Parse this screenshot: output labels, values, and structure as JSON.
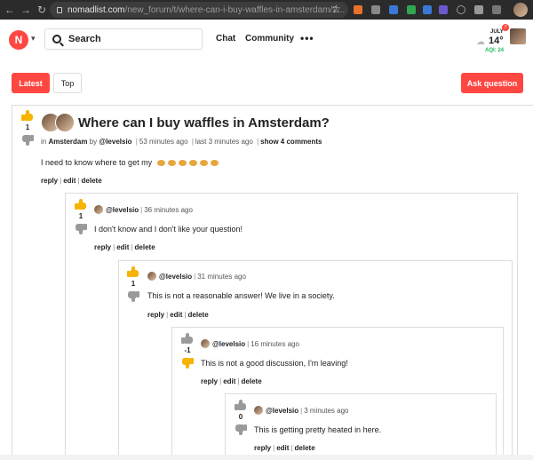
{
  "browser": {
    "url_domain": "nomadlist.com",
    "url_path": "/new_forum/t/where-can-i-buy-waffles-in-amsterdam/2..."
  },
  "header": {
    "logo_text": "N",
    "search_placeholder": "Search",
    "nav": {
      "chat": "Chat",
      "community": "Community",
      "more": "•••"
    },
    "weather": {
      "month": "JULY",
      "badge": "7",
      "temp": "14°",
      "aqi": "AQI: 24"
    }
  },
  "tabs": {
    "latest": "Latest",
    "top": "Top",
    "ask": "Ask question"
  },
  "colors": {
    "accent": "#ff4742",
    "vote_active": "#f5b400",
    "vote_inactive": "#9a9a9a",
    "aqi": "#1db954"
  },
  "post": {
    "score": "1",
    "title": "Where can I buy waffles in Amsterdam?",
    "meta": {
      "prefix": "in",
      "location": "Amsterdam",
      "by": "by",
      "author": "@levelsio",
      "posted": "53 minutes ago",
      "last": "last 3 minutes ago",
      "show_comments": "show 4 comments"
    },
    "body": "I need to know where to get my",
    "waffle_count": 6,
    "actions": {
      "reply": "reply",
      "edit": "edit",
      "delete": "delete"
    }
  },
  "comments": [
    {
      "score": "1",
      "author": "@levelsio",
      "time": "36 minutes ago",
      "text": "I don't know and I don't like your question!",
      "vote": "up",
      "actions": {
        "reply": "reply",
        "edit": "edit",
        "delete": "delete"
      }
    },
    {
      "score": "1",
      "author": "@levelsio",
      "time": "31 minutes ago",
      "text": "This is not a reasonable answer! We live in a society.",
      "vote": "up",
      "actions": {
        "reply": "reply",
        "edit": "edit",
        "delete": "delete"
      }
    },
    {
      "score": "-1",
      "author": "@levelsio",
      "time": "16 minutes ago",
      "text": "This is not a good discussion, I'm leaving!",
      "vote": "down",
      "actions": {
        "reply": "reply",
        "edit": "edit",
        "delete": "delete"
      }
    },
    {
      "score": "0",
      "author": "@levelsio",
      "time": "3 minutes ago",
      "text": "This is getting pretty heated in here.",
      "vote": "none",
      "actions": {
        "reply": "reply",
        "edit": "edit",
        "delete": "delete"
      }
    }
  ]
}
